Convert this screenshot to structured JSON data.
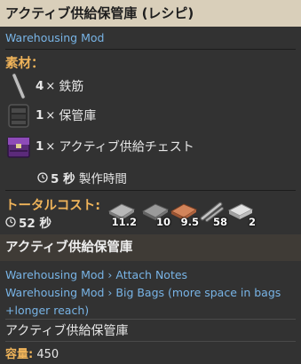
{
  "header": {
    "title": "アクティブ供給保管庫 (レシピ)"
  },
  "mod_source": "Warehousing Mod",
  "ingredients": {
    "title": "素材：",
    "items": [
      {
        "amount": "4",
        "x": "×",
        "name": "鉄筋",
        "icon": "iron-stick-icon"
      },
      {
        "amount": "1",
        "x": "×",
        "name": "保管庫",
        "icon": "warehouse-icon"
      },
      {
        "amount": "1",
        "x": "×",
        "name": "アクティブ供給チェスト",
        "icon": "active-provider-chest-icon"
      }
    ]
  },
  "craft_time": {
    "value": "5 秒",
    "label": "製作時間"
  },
  "total_cost": {
    "title": "トータルコスト:",
    "time": "52 秒",
    "resources": [
      {
        "icon": "iron-plate-icon",
        "value": "11.2",
        "color": "#b8b8b8"
      },
      {
        "icon": "steel-plate-icon",
        "value": "10",
        "color": "#9a9a9a"
      },
      {
        "icon": "copper-plate-icon",
        "value": "9.5",
        "color": "#c87850"
      },
      {
        "icon": "iron-stick-icon",
        "value": "58",
        "color": "#a8a8a8"
      },
      {
        "icon": "stone-brick-icon",
        "value": "2",
        "color": "#d0d0d0"
      }
    ]
  },
  "item": {
    "title": "アクティブ供給保管庫",
    "notes": [
      "Warehousing Mod › Attach Notes",
      "Warehousing Mod › Big Bags (more space in bags +longer reach)"
    ],
    "description": "アクティブ供給保管庫",
    "capacity_label": "容量:",
    "capacity_value": "450"
  }
}
